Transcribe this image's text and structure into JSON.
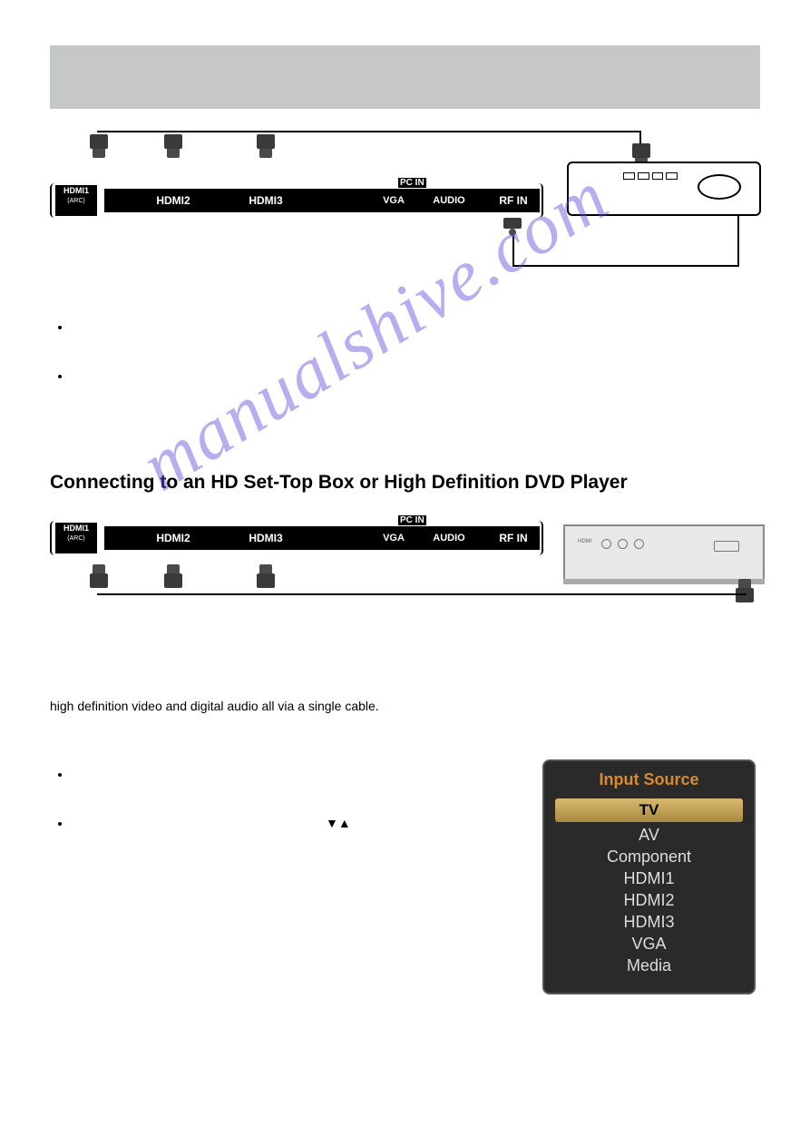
{
  "header": {
    "band": ""
  },
  "diagram1": {
    "ports": {
      "hdmi1_line1": "HDMI1",
      "hdmi1_line2": "(ARC)",
      "hdmi2": "HDMI2",
      "hdmi3": "HDMI3",
      "pcin": "PC IN",
      "vga": "VGA",
      "audio": "AUDIO",
      "rfin": "RF IN"
    }
  },
  "section1": {
    "bullets": [
      "",
      ""
    ]
  },
  "section2": {
    "title": "Connecting to an HD Set-Top Box or High Definition DVD Player",
    "paragraph": "high definition video and digital audio all via a single cable.",
    "ports": {
      "hdmi1_line1": "HDMI1",
      "hdmi1_line2": "(ARC)",
      "hdmi2": "HDMI2",
      "hdmi3": "HDMI3",
      "pcin": "PC IN",
      "vga": "VGA",
      "audio": "AUDIO",
      "rfin": "RF IN"
    },
    "stb_label": "HDMI",
    "bullets_after": [
      "",
      ""
    ],
    "arrows": "▼▲"
  },
  "osd": {
    "title": "Input Source",
    "items": [
      "TV",
      "AV",
      "Component",
      "HDMI1",
      "HDMI2",
      "HDMI3",
      "VGA",
      "Media"
    ],
    "selected_index": 0
  },
  "watermark": "manualshive.com"
}
